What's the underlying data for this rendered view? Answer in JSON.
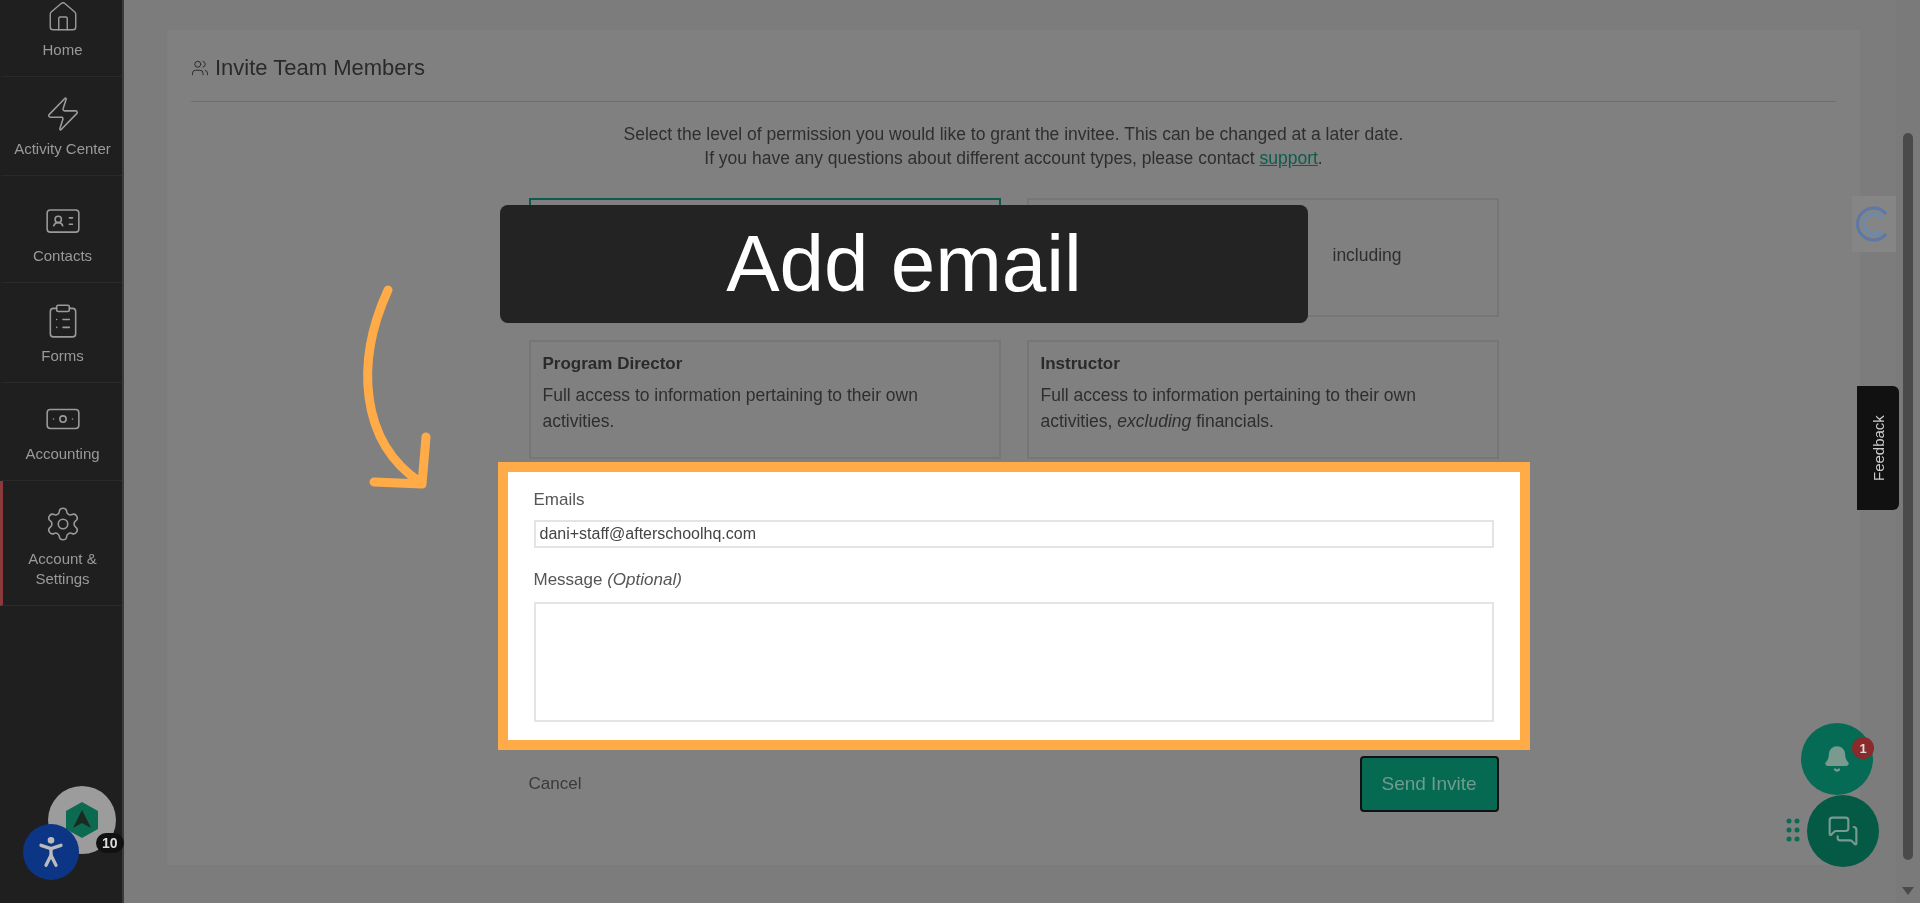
{
  "sidebar": {
    "items": [
      {
        "kind": "home",
        "label": "Home",
        "selected": false
      },
      {
        "kind": "activity",
        "label": "Activity Center",
        "selected": false
      },
      {
        "kind": "contacts",
        "label": "Contacts",
        "selected": false
      },
      {
        "kind": "forms",
        "label": "Forms",
        "selected": false
      },
      {
        "kind": "accounting",
        "label": "Accounting",
        "selected": false
      },
      {
        "kind": "settings",
        "label": "Account & Settings",
        "selected": true
      }
    ],
    "avatar_badge": "10"
  },
  "page": {
    "title": "Invite Team Members",
    "intro": "Select the level of permission you would like to grant the invitee. This can be changed at a later date.",
    "contact_text": "If you have any questions about different account types, please contact ",
    "support_link": "support",
    "contact_end": "."
  },
  "roles": [
    {
      "selected": true
    },
    {
      "description": "including",
      "selected": false
    },
    {
      "title": "Program Director",
      "description": "Full access to information pertaining to their own activities.",
      "selected": false
    },
    {
      "title": "Instructor",
      "description": "Full access to information pertaining to their own activities, *excluding* financials.",
      "selected": false
    }
  ],
  "form": {
    "emails_label": "Emails",
    "emails_value": "dani+staff@afterschoolhq.com",
    "message_label": "Message *(Optional)*",
    "cancel": "Cancel",
    "submit": "Send Invite"
  },
  "caption": "Add email",
  "feedback": "Feedback",
  "notifications": {
    "count": "1"
  }
}
